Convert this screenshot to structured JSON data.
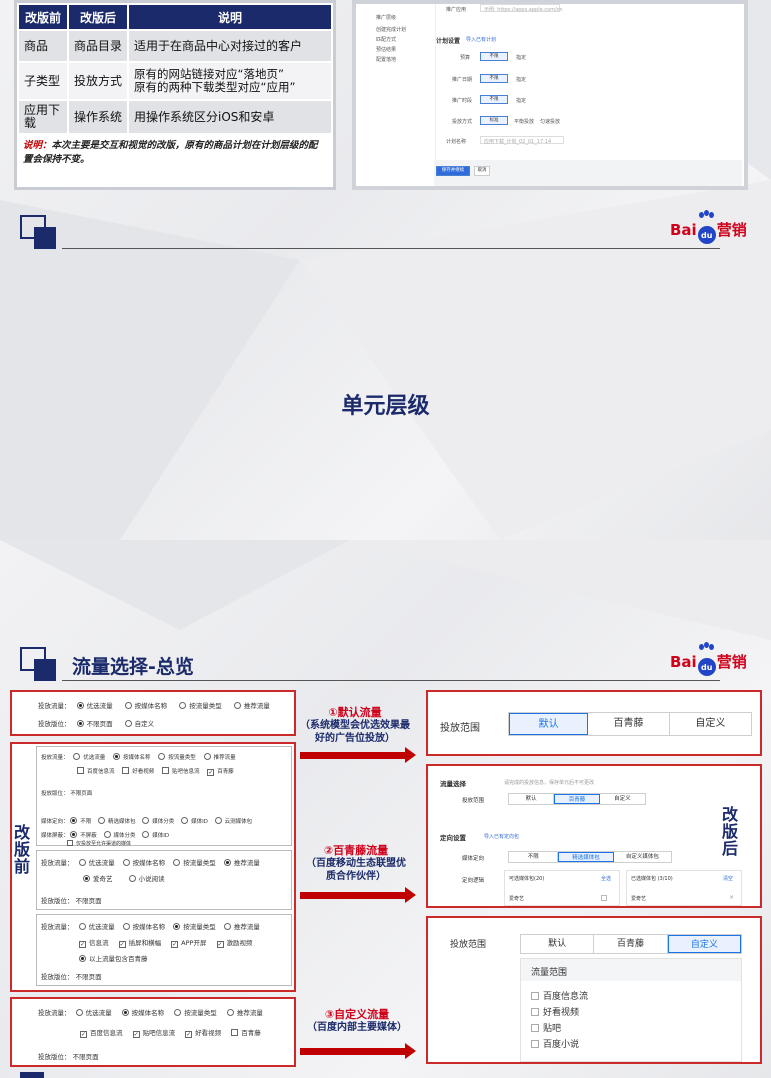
{
  "comparison_table": {
    "headers": [
      "改版前",
      "改版后",
      "说明"
    ],
    "rows": [
      [
        "商品",
        "商品目录",
        "适用于在商品中心对接过的客户"
      ],
      [
        "子类型",
        "投放方式",
        "原有的网站链接对应“落地页”\n原有的两种下载类型对应“应用”"
      ],
      [
        "应用下载",
        "操作系统",
        "用操作系统区分iOS和安卓"
      ]
    ],
    "note_label": "说明：",
    "note_text": "本次主要是交互和视觉的改版，原有的商品计划在计划层级的配置会保持不变。"
  },
  "mini_shot": {
    "sidebar": [
      "推广层级",
      "创建完成计划",
      "匹配方式",
      "预估结果",
      "配置落地"
    ],
    "promo_app_label": "推广应用",
    "promo_app_placeholder": "示例: https://apps.apple.com/cn",
    "plan_settings": "计划设置",
    "plan_link": "导入已有计划",
    "rows": [
      {
        "label": "预算",
        "opts": [
          "不限",
          "指定"
        ]
      },
      {
        "label": "推广日期",
        "opts": [
          "不限",
          "指定"
        ]
      },
      {
        "label": "推广时段",
        "opts": [
          "不限",
          "指定"
        ]
      },
      {
        "label": "投放方式",
        "opts": [
          "标准",
          "平衡投放",
          "匀速投放"
        ]
      }
    ],
    "plan_name_label": "计划名称",
    "plan_name_value": "应用下载_计划_02_01_17:14",
    "save_btn": "保存并继续",
    "cancel_btn": "取消"
  },
  "brand": {
    "bai": "Bai",
    "du": "du",
    "ying": "营销"
  },
  "section_title": "单元层级",
  "page_title": "流量选择-总览",
  "vertical_before": "改版前",
  "vertical_after": "改版后",
  "top_panel": {
    "row1_label": "投放流量：",
    "row1_opts": [
      "优选流量",
      "按媒体名称",
      "按流量类型",
      "推荐流量"
    ],
    "row2_label": "投放版位：",
    "row2_opts": [
      "不限页面",
      "自定义"
    ]
  },
  "before_panel": {
    "r1_label": "投放流量：",
    "r1_opts": [
      "优选流量",
      "按媒体名称",
      "按流量类型",
      "推荐流量"
    ],
    "r1_checks": [
      "百度信息流",
      "好看视频",
      "贴吧信息流",
      "百青藤"
    ],
    "r2_label": "投放版位：",
    "r2_value": "不限页面",
    "r3_label": "媒体定向：",
    "r3_opts": [
      "不限",
      "精选媒体包",
      "媒体分类",
      "媒体ID",
      "云测媒体包"
    ],
    "r4_label": "媒体屏蔽：",
    "r4_opts": [
      "不屏蔽",
      "媒体分类",
      "媒体ID"
    ],
    "r4_check": "仅投放至允许渠道的媒体",
    "r5_label": "投放流量：",
    "r5_opts": [
      "优选流量",
      "按媒体名称",
      "按流量类型",
      "推荐流量"
    ],
    "r5_sub": [
      "爱奇艺",
      "小说阅读"
    ],
    "r6_label": "投放版位：",
    "r6_value": "不限页面",
    "r7_label": "投放流量：",
    "r7_opts": [
      "优选流量",
      "按媒体名称",
      "按流量类型",
      "推荐流量"
    ],
    "r7_checks": [
      "信息流",
      "插屏和横幅",
      "APP开屏",
      "激励视频"
    ],
    "r7_sub": "以上流量包含百青藤",
    "r8_label": "投放版位：",
    "r8_value": "不限页面",
    "r9_label": "投放流量：",
    "r9_opts": [
      "优选流量",
      "按媒体名称",
      "按流量类型",
      "推荐流量"
    ],
    "r9_checks": [
      "百度信息流",
      "贴吧信息流",
      "好看视频",
      "百青藤"
    ],
    "r10_label": "投放版位：",
    "r10_value": "不限页面"
  },
  "arrows": [
    {
      "title": "①默认流量",
      "desc": "（系统模型会优选效果最好的广告位投放）"
    },
    {
      "title": "②百青藤流量",
      "desc": "（百度移动生态联盟优质合作伙伴）"
    },
    {
      "title": "③自定义流量",
      "desc": "（百度内部主要媒体）"
    }
  ],
  "after1": {
    "label": "投放范围",
    "opts": [
      "默认",
      "百青藤",
      "自定义"
    ]
  },
  "after2": {
    "title": "流量选择",
    "hint": "请完成的投放信息，保存单元后不可更改",
    "scope_label": "投放范围",
    "scope_opts": [
      "默认",
      "百青藤",
      "自定义"
    ],
    "targeting_title": "定向设置",
    "targeting_link": "导入已有定向包",
    "media_label": "媒体定向",
    "media_opts": [
      "不限",
      "精选媒体包",
      "自定义媒体包"
    ],
    "logic_label": "定向逻辑",
    "avail_label": "可选媒体包(20)",
    "select_all": "全选",
    "chosen_label": "已选媒体包 (3/10)",
    "clear": "清空",
    "item": "爱奇艺"
  },
  "after3": {
    "label": "投放范围",
    "opts": [
      "默认",
      "百青藤",
      "自定义"
    ],
    "list_title": "流量范围",
    "items": [
      "百度信息流",
      "好看视频",
      "贴吧",
      "百度小说"
    ]
  }
}
